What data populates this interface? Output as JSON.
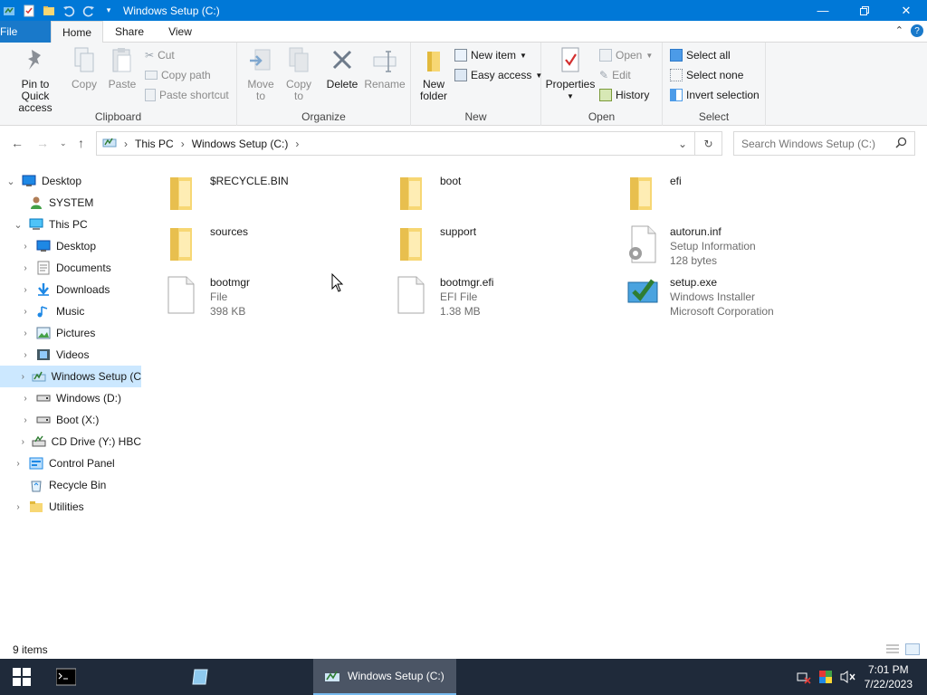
{
  "window": {
    "title": "Windows Setup (C:)"
  },
  "tabs": {
    "file": "File",
    "home": "Home",
    "share": "Share",
    "view": "View"
  },
  "ribbon": {
    "clipboard": {
      "label": "Clipboard",
      "pin": "Pin to Quick access",
      "copy": "Copy",
      "paste": "Paste",
      "cut": "Cut",
      "copy_path": "Copy path",
      "paste_shortcut": "Paste shortcut"
    },
    "organize": {
      "label": "Organize",
      "move_to": "Move to",
      "copy_to": "Copy to",
      "delete": "Delete",
      "rename": "Rename"
    },
    "new": {
      "label": "New",
      "new_folder": "New folder",
      "new_item": "New item",
      "easy_access": "Easy access"
    },
    "open": {
      "label": "Open",
      "properties": "Properties",
      "open": "Open",
      "edit": "Edit",
      "history": "History"
    },
    "select": {
      "label": "Select",
      "select_all": "Select all",
      "select_none": "Select none",
      "invert": "Invert selection"
    }
  },
  "address": {
    "parts": [
      "This PC",
      "Windows Setup (C:)"
    ]
  },
  "search": {
    "placeholder": "Search Windows Setup (C:)"
  },
  "nav": [
    {
      "label": "Desktop",
      "level": 0,
      "expanded": true
    },
    {
      "label": "SYSTEM",
      "level": 1
    },
    {
      "label": "This PC",
      "level": 1,
      "expanded": true
    },
    {
      "label": "Desktop",
      "level": 2
    },
    {
      "label": "Documents",
      "level": 2
    },
    {
      "label": "Downloads",
      "level": 2
    },
    {
      "label": "Music",
      "level": 2
    },
    {
      "label": "Pictures",
      "level": 2
    },
    {
      "label": "Videos",
      "level": 2
    },
    {
      "label": "Windows Setup (C",
      "level": 2,
      "selected": true
    },
    {
      "label": "Windows (D:)",
      "level": 2
    },
    {
      "label": "Boot (X:)",
      "level": 2
    },
    {
      "label": "CD Drive (Y:) HBC",
      "level": 2
    },
    {
      "label": "Control Panel",
      "level": 1
    },
    {
      "label": "Recycle Bin",
      "level": 1
    },
    {
      "label": "Utilities",
      "level": 1
    }
  ],
  "files": [
    {
      "name": "$RECYCLE.BIN",
      "sub1": "",
      "sub2": "",
      "icon": "folder-icon"
    },
    {
      "name": "boot",
      "sub1": "",
      "sub2": "",
      "icon": "folder-icon"
    },
    {
      "name": "efi",
      "sub1": "",
      "sub2": "",
      "icon": "folder-icon"
    },
    {
      "name": "sources",
      "sub1": "",
      "sub2": "",
      "icon": "folder-icon"
    },
    {
      "name": "support",
      "sub1": "",
      "sub2": "",
      "icon": "folder-icon"
    },
    {
      "name": "autorun.inf",
      "sub1": "Setup Information",
      "sub2": "128 bytes",
      "icon": "settings-file-icon"
    },
    {
      "name": "bootmgr",
      "sub1": "File",
      "sub2": "398 KB",
      "icon": "file-icon"
    },
    {
      "name": "bootmgr.efi",
      "sub1": "EFI File",
      "sub2": "1.38 MB",
      "icon": "file-icon"
    },
    {
      "name": "setup.exe",
      "sub1": "Windows Installer",
      "sub2": "Microsoft Corporation",
      "icon": "installer-icon"
    }
  ],
  "status": {
    "items": "9 items"
  },
  "taskbar": {
    "active": "Windows Setup (C:)",
    "time": "7:01 PM",
    "date": "7/22/2023"
  },
  "colors": {
    "accent": "#0078d7",
    "selection": "#cce8ff",
    "folder": "#f7d774",
    "taskbar": "#1f2a3a"
  }
}
